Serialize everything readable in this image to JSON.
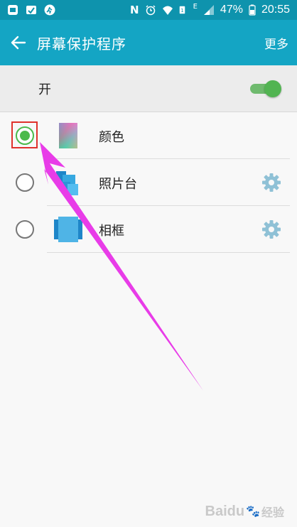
{
  "status_bar": {
    "notification_icons": [
      "app-icon",
      "photo-gallery-icon",
      "running-icon"
    ],
    "system_icons": [
      "n-icon",
      "alarm-icon",
      "wifi-icon",
      "sim-icon",
      "signal-icon"
    ],
    "network_type": "E",
    "battery": "47%",
    "time": "20:55"
  },
  "app_bar": {
    "back_icon": "arrow-left-icon",
    "title": "屏幕保护程序",
    "more_label": "更多"
  },
  "master_switch": {
    "label": "开",
    "state": true
  },
  "screensavers": [
    {
      "label": "颜色",
      "selected": true,
      "has_settings": false,
      "icon": "color-gradient-icon"
    },
    {
      "label": "照片台",
      "selected": false,
      "has_settings": true,
      "icon": "photo-table-icon"
    },
    {
      "label": "相框",
      "selected": false,
      "has_settings": true,
      "icon": "photo-frame-icon"
    }
  ],
  "colors": {
    "status_bar": "#0e93ad",
    "app_bar": "#14a5c4",
    "accent_green": "#4cba4c",
    "gear": "#8fc1d6",
    "annotation_arrow": "#e83ce8",
    "annotation_box": "#e0322c"
  },
  "watermark": {
    "brand": "Baidu",
    "subtext": "经验"
  }
}
